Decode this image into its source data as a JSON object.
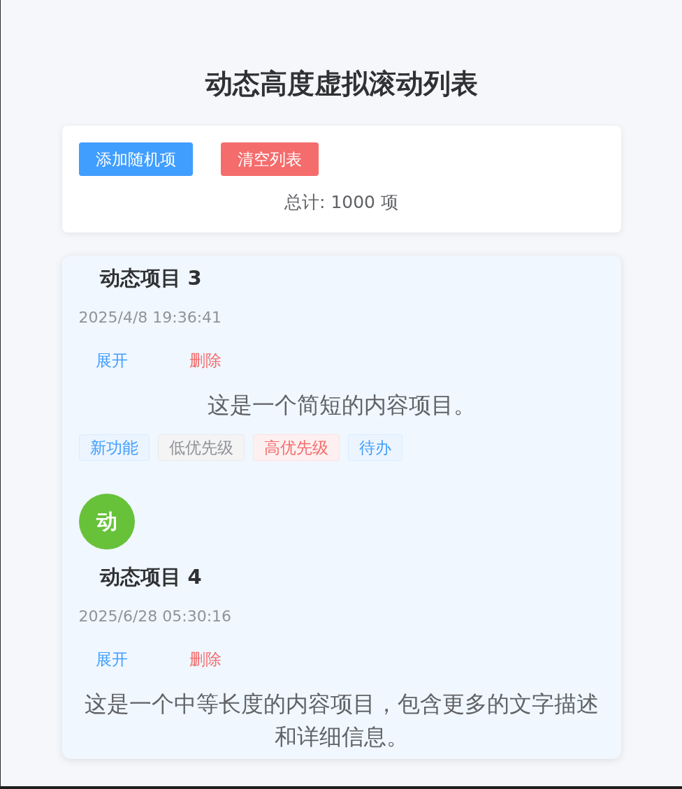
{
  "title": "动态高度虚拟滚动列表",
  "toolbar": {
    "buttons": [
      {
        "label": "添加随机项",
        "kind": "primary"
      },
      {
        "label": "清空列表",
        "kind": "danger"
      }
    ],
    "total": "总计: 1000 项"
  },
  "list": {
    "items": [
      {
        "title": "动态项目 3",
        "time": "2025/4/8 19:36:41",
        "actions": [
          {
            "label": "展开",
            "kind": "primary"
          },
          {
            "label": "删除",
            "kind": "danger"
          }
        ],
        "content": "这是一个简短的内容项目。",
        "tags": [
          {
            "label": "新功能",
            "kind": "primary"
          },
          {
            "label": "低优先级",
            "kind": "info"
          },
          {
            "label": "高优先级",
            "kind": "danger"
          },
          {
            "label": "待办",
            "kind": "primary"
          }
        ]
      },
      {
        "avatar": {
          "text": "动",
          "color": "#67c23a"
        },
        "title": "动态项目 4",
        "time": "2025/6/28 05:30:16",
        "actions": [
          {
            "label": "展开",
            "kind": "primary"
          },
          {
            "label": "删除",
            "kind": "danger"
          }
        ],
        "content": "这是一个中等长度的内容项目，包含更多的文字描述和详细信息。"
      }
    ]
  }
}
